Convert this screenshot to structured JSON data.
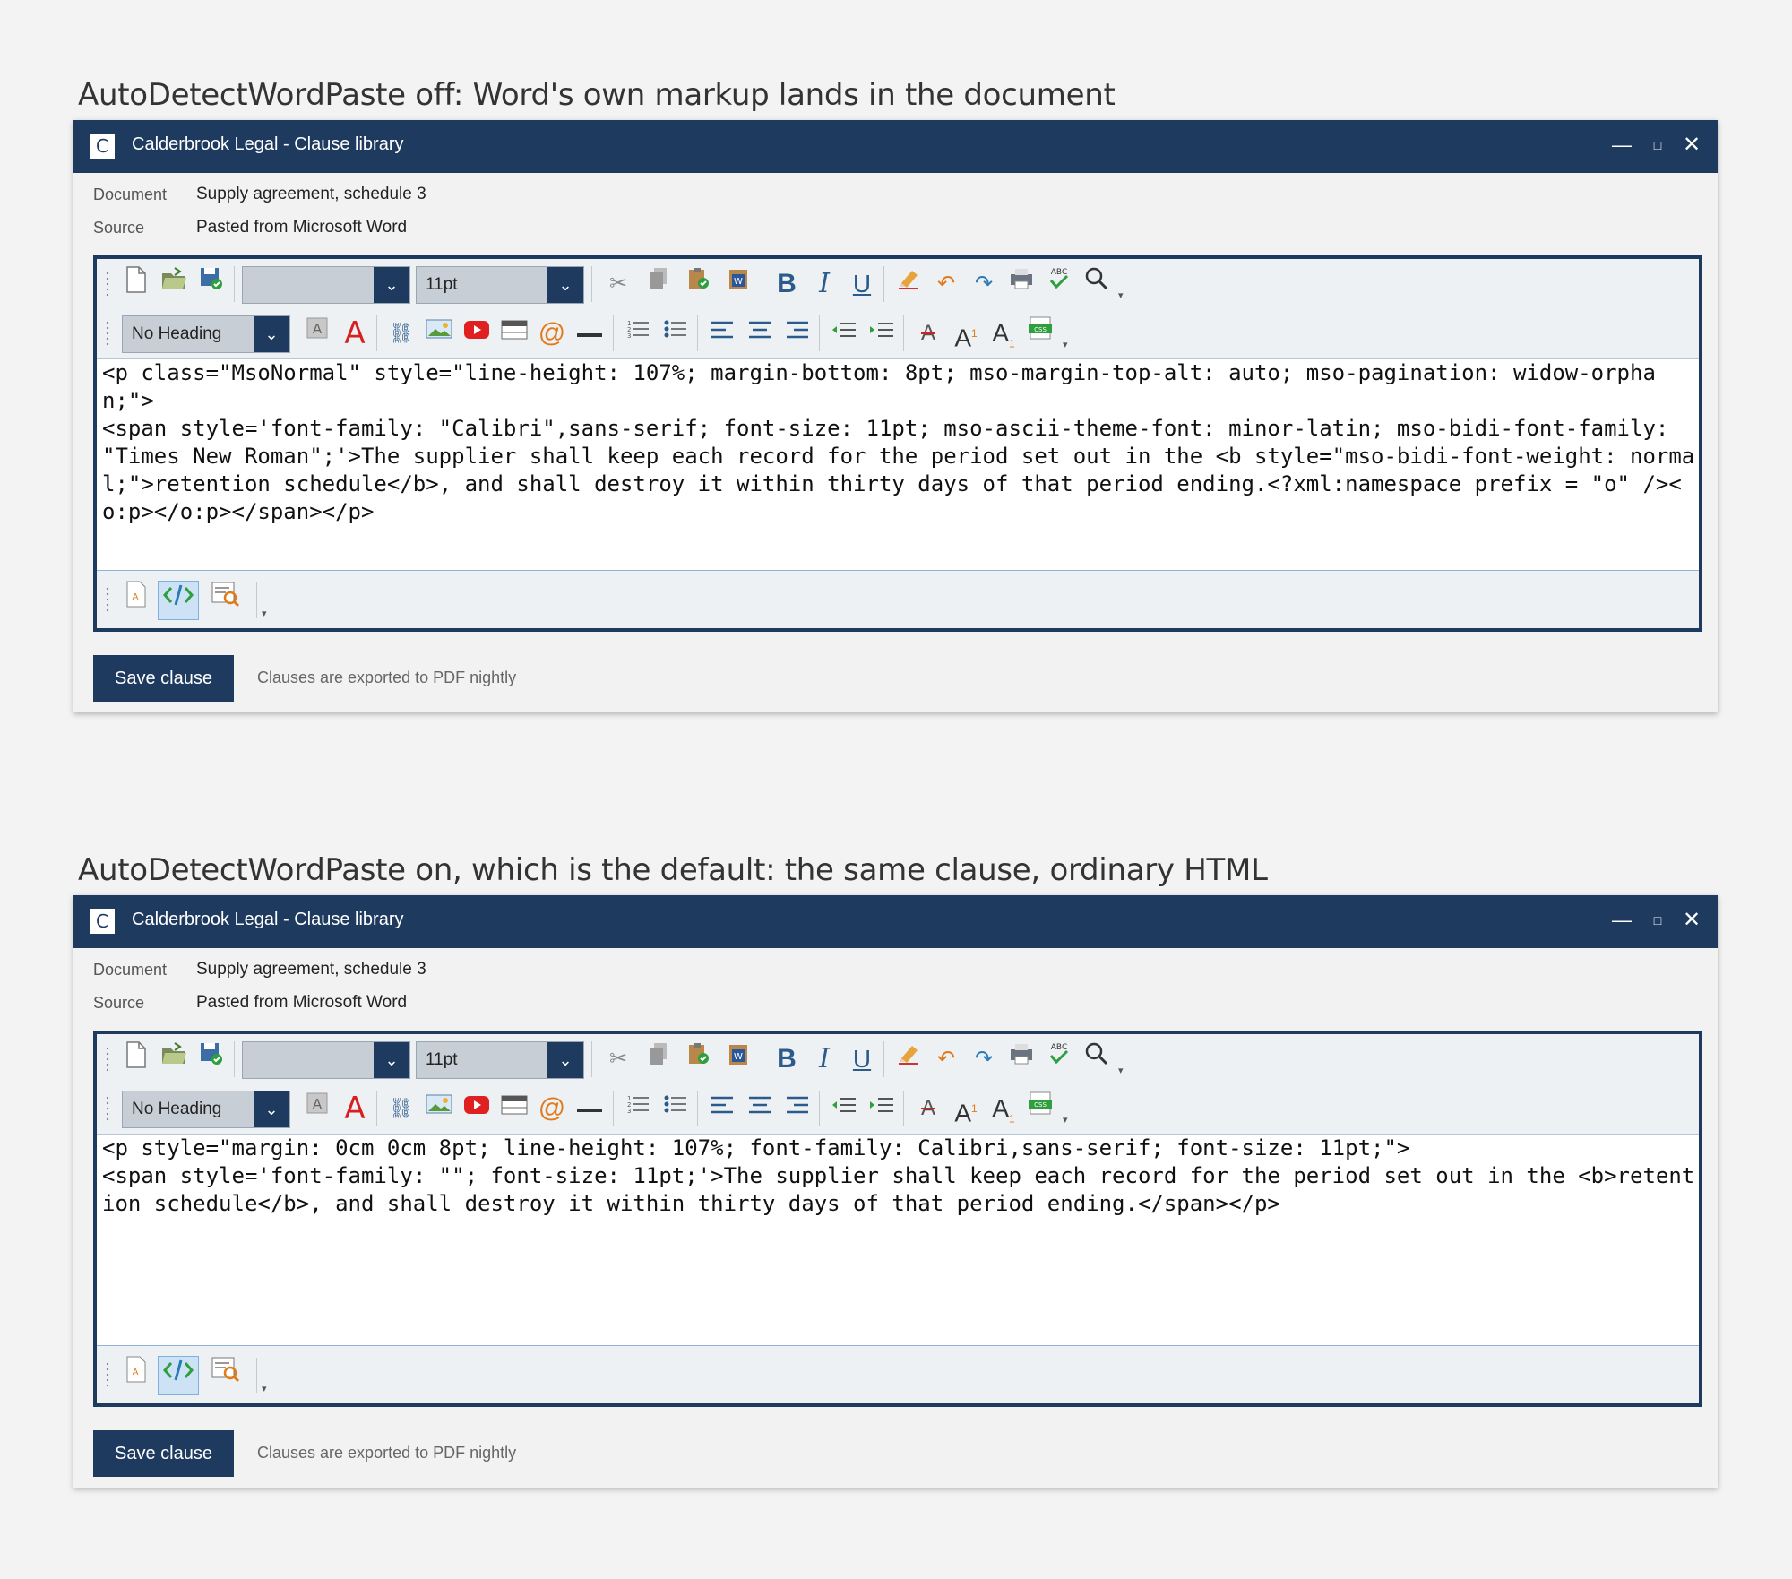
{
  "sections": [
    {
      "heading": "AutoDetectWordPaste off: Word's own markup lands in the document",
      "window": {
        "logo": "C",
        "title": "Calderbrook Legal - Clause library",
        "controls": {
          "minimize": "—",
          "maximize": "□",
          "close": "✕"
        }
      },
      "meta": [
        {
          "label": "Document",
          "value": "Supply agreement, schedule 3"
        },
        {
          "label": "Source",
          "value": "Pasted from Microsoft Word"
        }
      ],
      "toolbar": {
        "font_name": "",
        "font_size": "11pt",
        "heading": "No Heading"
      },
      "content_lines": [
        "<p class=\"MsoNormal\" style=\"line-height: 107%; margin-bottom: 8pt; mso-margin-top-alt: auto; mso-pagination: widow-orphan;\">",
        "<span style='font-family: \"Calibri\",sans-serif; font-size: 11pt; mso-ascii-theme-font: minor-latin; mso-bidi-font-family: \"Times New Roman\";'>The supplier shall keep each record for the period set out in the <b style=\"mso-bidi-font-weight: normal;\">retention schedule</b>, and shall destroy it within thirty days of that period ending.<?xml:namespace prefix = \"o\" /><o:p></o:p></span></p>"
      ],
      "save_label": "Save clause",
      "footnote": "Clauses are exported to PDF nightly"
    },
    {
      "heading": "AutoDetectWordPaste on, which is the default: the same clause, ordinary HTML",
      "window": {
        "logo": "C",
        "title": "Calderbrook Legal - Clause library",
        "controls": {
          "minimize": "—",
          "maximize": "□",
          "close": "✕"
        }
      },
      "meta": [
        {
          "label": "Document",
          "value": "Supply agreement, schedule 3"
        },
        {
          "label": "Source",
          "value": "Pasted from Microsoft Word"
        }
      ],
      "toolbar": {
        "font_name": "",
        "font_size": "11pt",
        "heading": "No Heading"
      },
      "content_lines": [
        "<p style=\"margin: 0cm 0cm 8pt; line-height: 107%; font-family: Calibri,sans-serif; font-size: 11pt;\">",
        "<span style='font-family: \"\"; font-size: 11pt;'>The supplier shall keep each record for the period set out in the <b>retention schedule</b>, and shall destroy it within thirty days of that period ending.</span></p>"
      ],
      "save_label": "Save clause",
      "footnote": "Clauses are exported to PDF nightly"
    }
  ],
  "icons": {
    "toolbar1": [
      "new-document-icon",
      "open-folder-icon",
      "save-icon",
      "cut-icon",
      "copy-icon",
      "paste-icon",
      "paste-from-word-icon",
      "bold-icon",
      "italic-icon",
      "underline-icon",
      "clear-format-icon",
      "undo-icon",
      "redo-icon",
      "print-icon",
      "spellcheck-icon",
      "find-icon"
    ],
    "toolbar2": [
      "font-highlight-icon",
      "font-color-icon",
      "link-icon",
      "image-icon",
      "video-icon",
      "table-icon",
      "email-link-icon",
      "horizontal-rule-icon",
      "numbered-list-icon",
      "bullet-list-icon",
      "align-left-icon",
      "align-center-icon",
      "align-right-icon",
      "outdent-icon",
      "indent-icon",
      "strikethrough-icon",
      "superscript-icon",
      "subscript-icon",
      "css-class-icon"
    ],
    "modes": [
      "design-mode-icon",
      "html-mode-icon",
      "preview-mode-icon"
    ]
  },
  "colors": {
    "accent": "#1e3a5f",
    "background": "#f3f3f3",
    "font_color_icon": "#d62020"
  }
}
